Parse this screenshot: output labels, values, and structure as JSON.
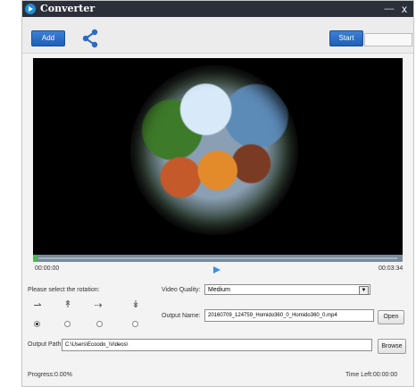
{
  "window": {
    "title": "Converter",
    "minimize": "—",
    "close": "x"
  },
  "toolbar": {
    "add_label": "Add",
    "start_label": "Start"
  },
  "player": {
    "time_current": "00:00:00",
    "time_total": "00:03:34",
    "progress_fraction": 0.01
  },
  "rotation": {
    "label": "Please select the rotation:",
    "options": [
      {
        "icon": "rotate-none-icon",
        "glyph": "⇀",
        "checked": true
      },
      {
        "icon": "rotate-up-icon",
        "glyph": "↟",
        "checked": false
      },
      {
        "icon": "rotate-right-icon",
        "glyph": "⇢",
        "checked": false
      },
      {
        "icon": "rotate-down-icon",
        "glyph": "↡",
        "checked": false
      }
    ]
  },
  "quality": {
    "label": "Video Quality:",
    "selected": "Medium"
  },
  "output_name": {
    "label": "Output Name:",
    "value": "20160709_124759_Homido360_0_Homido360_0.mp4",
    "open_label": "Open"
  },
  "output_path": {
    "label": "Output Path:",
    "value": "C:\\Users\\Ecoodo_\\Videos\\",
    "browse_label": "Browse"
  },
  "status": {
    "progress": "Progress:0.00%",
    "time_left": "Time Left:00:00:00"
  },
  "colors": {
    "titlebar": "#2b2f3a",
    "button_blue": "#2a6cc4",
    "seek_fill": "#3fbf3f"
  }
}
